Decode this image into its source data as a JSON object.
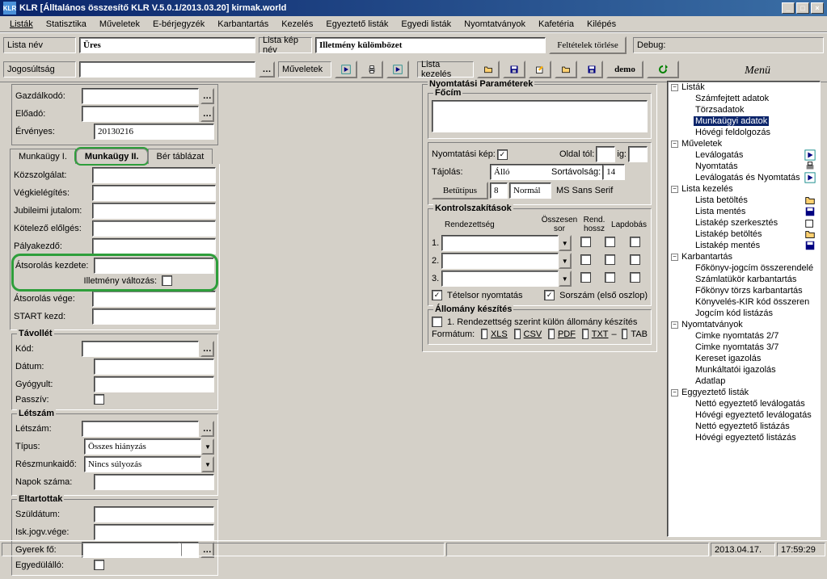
{
  "window": {
    "title": "KLR  [Álltalános összesítő KLR V.5.0.1/2013.03.20]  kirmak.world",
    "icon_label": "KLR"
  },
  "menu": [
    "Listák",
    "Statisztika",
    "Műveletek",
    "E-bérjegyzék",
    "Karbantartás",
    "Kezelés",
    "Egyeztető listák",
    "Egyedi listák",
    "Nyomtatványok",
    "Kafetéria",
    "Kilépés"
  ],
  "row1": {
    "lista_nev_label": "Lista név",
    "lista_nev_value": "Üres",
    "lista_kep_nev_label": "Lista kép név",
    "lista_kep_nev_value": "Illetmény külömbözet",
    "feltetelek_torlese": "Feltételek törlése",
    "debug_label": "Debug:"
  },
  "row2": {
    "jogosultsag_label": "Jogosúltság",
    "muveletek_label": "Műveletek",
    "lista_kezeles_label": "Lista kezelés",
    "demo_label": "demo"
  },
  "left": {
    "gazd": {
      "gazdkodo": "Gazdálkodó:",
      "eloado": "Előadó:",
      "ervenyes": "Érvényes:",
      "ervenyes_value": "20130216"
    },
    "tabs": [
      "Munkaügy I.",
      "Munkaügy II.",
      "Bér táblázat"
    ],
    "active_tab": 1,
    "fields2": {
      "kozszolg": "Közszolgálat:",
      "vegkielegites": "Végkielégítés:",
      "jubileumi": "Jubileimi jutalom:",
      "kotelezo": "Kötelező előlgés:",
      "palyakezdo": "Pályakezdő:",
      "atsor_kezdete": "Átsorolás kezdete:",
      "illetmeny_valtozas": "Illetmény változás:",
      "atsor_vege": "Átsorolás vége:",
      "start_kezd": "START kezd:"
    },
    "tavollet": {
      "title": "Távollét",
      "kod": "Kód:",
      "datum": "Dátum:",
      "gyogyult": "Gyógyult:",
      "passziv": "Passzív:"
    },
    "letszam": {
      "title": "Létszám",
      "letszam": "Létszám:",
      "tipus": "Típus:",
      "tipus_value": "Összes hiányzás",
      "reszmunkaido": "Részmunkaidő:",
      "reszm_value": "Nincs súlyozás",
      "napok": "Napok száma:"
    },
    "eltartottak": {
      "title": "Eltartottak",
      "szuldatum": "Szüldátum:",
      "iskjogv": "Isk.jogv.vége:",
      "gyerekfo": "Gyerek fő:",
      "egyedul": "Egyedülálló:"
    }
  },
  "mid": {
    "nyomt_param": "Nyomtatási Paraméterek",
    "focim": "Főcím",
    "nyomt_kep": "Nyomtatási kép:",
    "oldal_tol": "Oldal tól:",
    "ig": "ig:",
    "tajolas": "Tájolás:",
    "tajolas_value": "Álló",
    "sortavolsag": "Sortávolság:",
    "sortav_value": "14",
    "betutipus": "Betűtípus",
    "betu_size": "8",
    "betu_style": "Normál",
    "font_name": "MS Sans Serif",
    "kontrol": "Kontrolszakítások",
    "rendezettseg": "Rendezettség",
    "osszesen_sor": "Összesen sor",
    "rend_hossz": "Rend. hossz",
    "lapdobas": "Lapdobás",
    "k1": "1.",
    "k2": "2.",
    "k3": "3.",
    "tetelsor": "Tételsor nyomtatás",
    "sorszam": "Sorszám (első oszlop)",
    "allomany": "Állomány készítés",
    "rend_szerint": "1. Rendezettség szerint külön állomány készítés",
    "formatum": "Formátum:",
    "xls": "XLS",
    "csv": "CSV",
    "pdf": "PDF",
    "txt": "TXT",
    "tab": "TAB"
  },
  "right": {
    "menu_title": "Menü",
    "tree": [
      {
        "type": "root",
        "label": "Listák",
        "expanded": true,
        "children": [
          {
            "label": "Számfejtett adatok"
          },
          {
            "label": "Törzsadatok"
          },
          {
            "label": "Munkaügyi adatok",
            "selected": true
          },
          {
            "label": "Hóvégi feldolgozás"
          }
        ]
      },
      {
        "type": "root",
        "label": "Műveletek",
        "expanded": true,
        "children": [
          {
            "label": "Leválogatás",
            "icon": "play"
          },
          {
            "label": "Nyomtatás",
            "icon": "print"
          },
          {
            "label": "Leválogatás és Nyomtatás",
            "icon": "play2"
          }
        ]
      },
      {
        "type": "root",
        "label": "Lista kezelés",
        "expanded": true,
        "children": [
          {
            "label": "Lista betöltés",
            "icon": "folder"
          },
          {
            "label": "Lista mentés",
            "icon": "save"
          },
          {
            "label": "Listakép szerkesztés",
            "icon": "edit"
          },
          {
            "label": "Listakép betöltés",
            "icon": "folder"
          },
          {
            "label": "Listakép mentés",
            "icon": "save"
          }
        ]
      },
      {
        "type": "root",
        "label": "Karbantartás",
        "expanded": true,
        "children": [
          {
            "label": "Főkönyv-jogcím összerendelé"
          },
          {
            "label": "Számlatükör karbantartás"
          },
          {
            "label": "Főkönyv törzs karbantartás"
          },
          {
            "label": "Könyvelés-KIR kód összeren"
          },
          {
            "label": "Jogcím kód listázás"
          }
        ]
      },
      {
        "type": "root",
        "label": "Nyomtatványok",
        "expanded": true,
        "children": [
          {
            "label": "Cimke nyomtatás 2/7"
          },
          {
            "label": "Cimke nyomtatás 3/7"
          },
          {
            "label": "Kereset igazolás"
          },
          {
            "label": "Munkáltatói igazolás"
          },
          {
            "label": "Adatlap"
          }
        ]
      },
      {
        "type": "root",
        "label": "Eggyeztető listák",
        "expanded": true,
        "children": [
          {
            "label": "Nettó egyeztető leválogatás"
          },
          {
            "label": "Hóvégi egyeztető leválogatás"
          },
          {
            "label": "Nettó egyeztető listázás"
          },
          {
            "label": "Hóvégi egyeztető listázás"
          }
        ]
      }
    ]
  },
  "status": {
    "date": "2013.04.17.",
    "time": "17:59:29"
  }
}
